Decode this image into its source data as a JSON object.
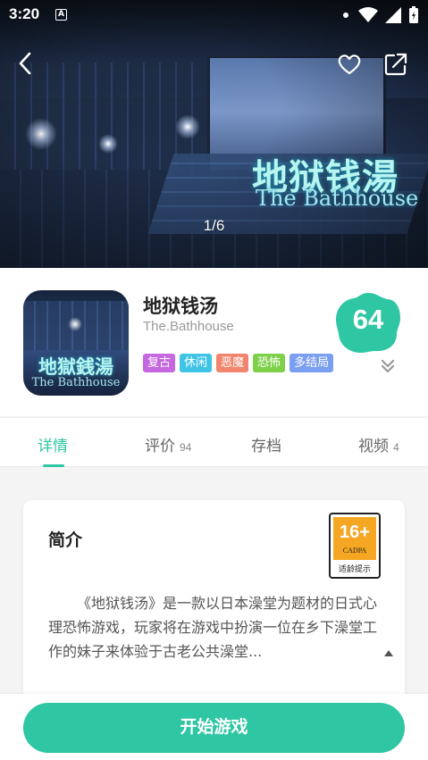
{
  "status_bar": {
    "time": "3:20",
    "a_label": "A"
  },
  "banner": {
    "title_cn": "地狱钱湯",
    "title_en": "The Bathhouse",
    "counter": "1/6"
  },
  "game": {
    "title": "地狱钱汤",
    "subtitle": "The.Bathhouse",
    "icon_cn": "地獄銭湯",
    "icon_en": "The Bathhouse",
    "score": "64",
    "score_color": "#2ec6a3",
    "tags": [
      {
        "label": "复古",
        "color": "#c568e0"
      },
      {
        "label": "休闲",
        "color": "#3fc4e6"
      },
      {
        "label": "恶魔",
        "color": "#f0846c"
      },
      {
        "label": "恐怖",
        "color": "#7dd048"
      },
      {
        "label": "多结局",
        "color": "#7a9ef0"
      }
    ]
  },
  "tabs": [
    {
      "label": "详情",
      "count": ""
    },
    {
      "label": "评价",
      "count": "94"
    },
    {
      "label": "存档",
      "count": ""
    },
    {
      "label": "视频",
      "count": "4"
    }
  ],
  "intro": {
    "title": "简介",
    "age": "16+",
    "age_org": "CADPA",
    "age_tip": "适龄提示",
    "text": "《地狱钱汤》是一款以日本澡堂为题材的日式心理恐怖游戏，玩家将在游戏中扮演一位在乡下澡堂工作的妹子来体验于古老公共澡堂..."
  },
  "actions": {
    "start": "开始游戏"
  },
  "accent_color": "#2ec6a3"
}
